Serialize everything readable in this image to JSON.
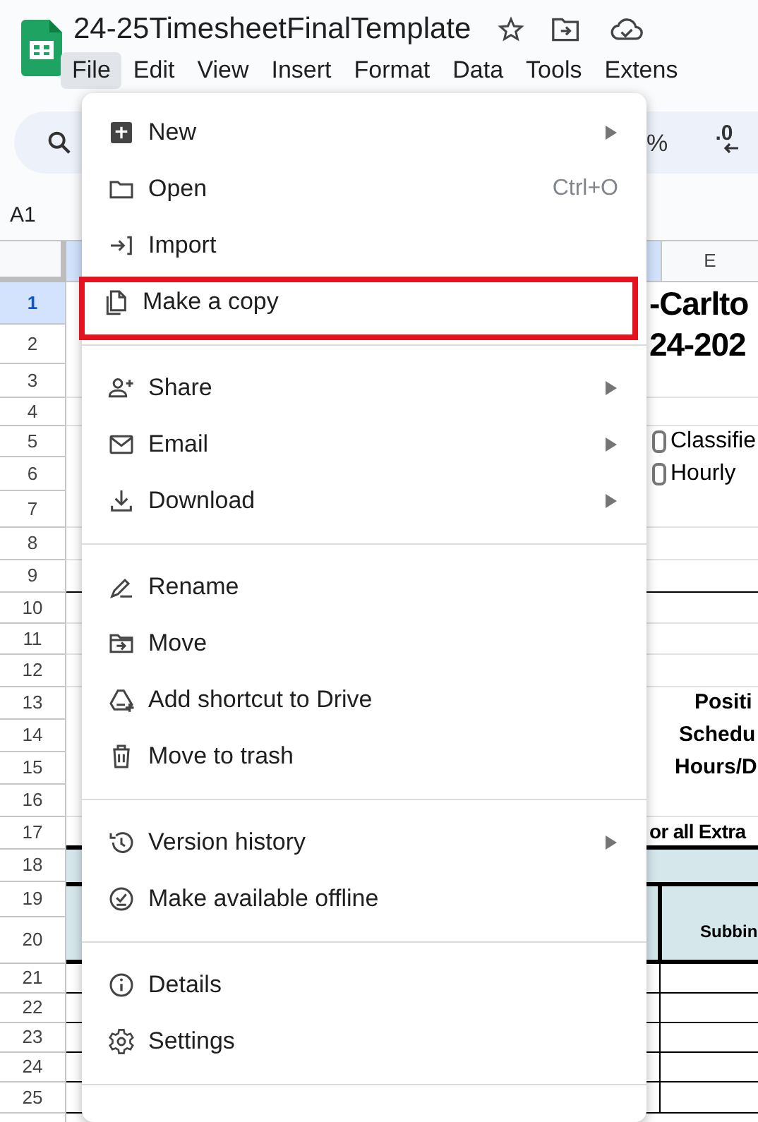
{
  "app": {
    "title": "24-25TimesheetFinalTemplate"
  },
  "menus": [
    {
      "label": "File",
      "selected": true
    },
    {
      "label": "Edit",
      "selected": false
    },
    {
      "label": "View",
      "selected": false
    },
    {
      "label": "Insert",
      "selected": false
    },
    {
      "label": "Format",
      "selected": false
    },
    {
      "label": "Data",
      "selected": false
    },
    {
      "label": "Tools",
      "selected": false
    },
    {
      "label": "Extens",
      "selected": false
    }
  ],
  "toolbar": {
    "percent": "%",
    "decimal": ".0"
  },
  "name_box": "A1",
  "columns": [
    {
      "label": "E"
    }
  ],
  "rows": [
    {
      "number": "1",
      "selected": true,
      "cell": {
        "kind": "title",
        "text": "-Carlto"
      }
    },
    {
      "number": "2",
      "selected": false,
      "cell": {
        "kind": "title",
        "text": "24-202"
      }
    },
    {
      "number": "3",
      "selected": false
    },
    {
      "number": "4",
      "selected": false
    },
    {
      "number": "5",
      "selected": false,
      "cell": {
        "kind": "check",
        "text": "Classifie",
        "checked": false
      }
    },
    {
      "number": "6",
      "selected": false,
      "cell": {
        "kind": "check",
        "text": "Hourly",
        "checked": false
      }
    },
    {
      "number": "7",
      "selected": false
    },
    {
      "number": "8",
      "selected": false
    },
    {
      "number": "9",
      "selected": false,
      "cell": {
        "kind": "rule"
      }
    },
    {
      "number": "10",
      "selected": false
    },
    {
      "number": "11",
      "selected": false
    },
    {
      "number": "12",
      "selected": false
    },
    {
      "number": "13",
      "selected": false,
      "cell": {
        "kind": "label",
        "text": "Positi"
      }
    },
    {
      "number": "14",
      "selected": false,
      "cell": {
        "kind": "label",
        "text": "Schedu"
      }
    },
    {
      "number": "15",
      "selected": false,
      "cell": {
        "kind": "label",
        "text": "Hours/D"
      }
    },
    {
      "number": "16",
      "selected": false
    },
    {
      "number": "17",
      "selected": false,
      "cell": {
        "kind": "heading",
        "text": "or all Extra"
      }
    },
    {
      "number": "18",
      "selected": false,
      "cell": {
        "kind": "band"
      }
    },
    {
      "number": "19",
      "selected": false,
      "cell": {
        "kind": "header"
      }
    },
    {
      "number": "20",
      "selected": false,
      "cell": {
        "kind": "header",
        "text": "Subbin"
      }
    },
    {
      "number": "21",
      "selected": false,
      "cell": {
        "kind": "grid"
      }
    },
    {
      "number": "22",
      "selected": false,
      "cell": {
        "kind": "grid"
      }
    },
    {
      "number": "23",
      "selected": false,
      "cell": {
        "kind": "grid"
      }
    },
    {
      "number": "24",
      "selected": false,
      "cell": {
        "kind": "grid"
      }
    },
    {
      "number": "25",
      "selected": false,
      "cell": {
        "kind": "grid"
      }
    }
  ],
  "file_menu": [
    {
      "kind": "item",
      "label": "New",
      "submenu": true,
      "highlighted": false
    },
    {
      "kind": "item",
      "label": "Open",
      "shortcut": "Ctrl+O",
      "submenu": false,
      "highlighted": false
    },
    {
      "kind": "item",
      "label": "Import",
      "submenu": false,
      "highlighted": false
    },
    {
      "kind": "item",
      "label": "Make a copy",
      "submenu": false,
      "highlighted": true
    },
    {
      "kind": "divider"
    },
    {
      "kind": "item",
      "label": "Share",
      "submenu": true,
      "highlighted": false
    },
    {
      "kind": "item",
      "label": "Email",
      "submenu": true,
      "highlighted": false
    },
    {
      "kind": "item",
      "label": "Download",
      "submenu": true,
      "highlighted": false
    },
    {
      "kind": "divider"
    },
    {
      "kind": "item",
      "label": "Rename",
      "submenu": false,
      "highlighted": false
    },
    {
      "kind": "item",
      "label": "Move",
      "submenu": false,
      "highlighted": false
    },
    {
      "kind": "item",
      "label": "Add shortcut to Drive",
      "submenu": false,
      "highlighted": false
    },
    {
      "kind": "item",
      "label": "Move to trash",
      "submenu": false,
      "highlighted": false
    },
    {
      "kind": "divider"
    },
    {
      "kind": "item",
      "label": "Version history",
      "submenu": true,
      "highlighted": false
    },
    {
      "kind": "item",
      "label": "Make available offline",
      "submenu": false,
      "highlighted": false
    },
    {
      "kind": "divider"
    },
    {
      "kind": "item",
      "label": "Details",
      "submenu": false,
      "highlighted": false
    },
    {
      "kind": "item",
      "label": "Settings",
      "submenu": false,
      "highlighted": false
    },
    {
      "kind": "divider"
    }
  ]
}
